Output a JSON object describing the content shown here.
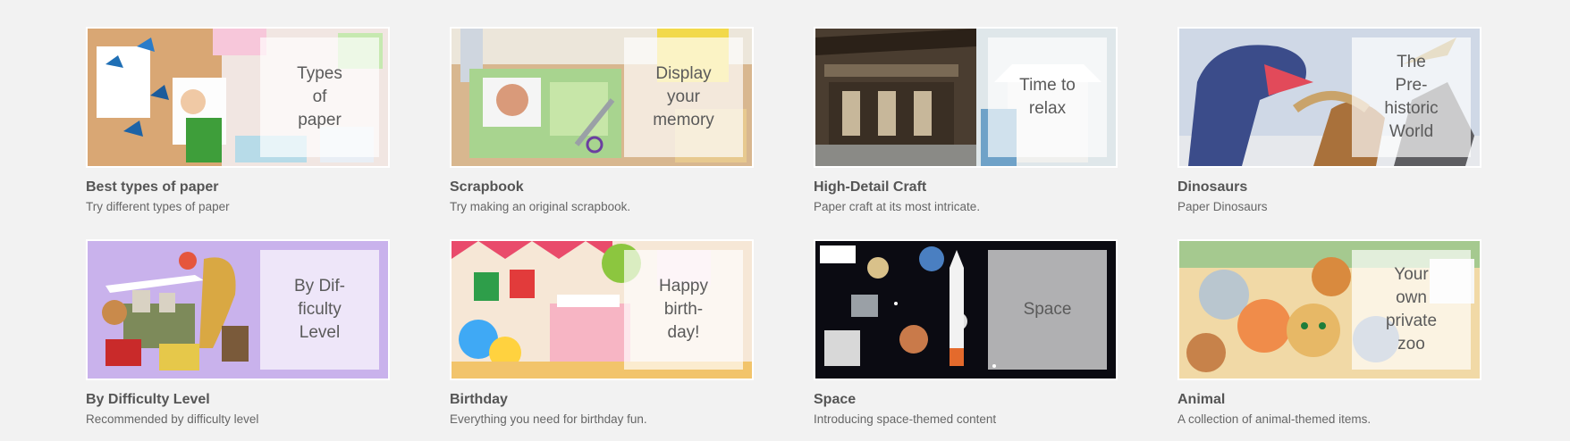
{
  "cards": [
    {
      "overlay": "Types\nof\npaper",
      "title": "Best types of paper",
      "subtitle": "Try different types of paper"
    },
    {
      "overlay": "Display\nyour\nmemory",
      "title": "Scrapbook",
      "subtitle": "Try making an original scrapbook."
    },
    {
      "overlay": "Time to\nrelax",
      "title": "High-Detail Craft",
      "subtitle": "Paper craft at its most intricate."
    },
    {
      "overlay": "The\nPre-\nhistoric\nWorld",
      "title": "Dinosaurs",
      "subtitle": "Paper Dinosaurs"
    },
    {
      "overlay": "By Dif-\nficulty\nLevel",
      "title": "By Difficulty Level",
      "subtitle": "Recommended by difficulty level"
    },
    {
      "overlay": "Happy\nbirth-\nday!",
      "title": "Birthday",
      "subtitle": "Everything you need for birthday fun."
    },
    {
      "overlay": "Space",
      "title": "Space",
      "subtitle": "Introducing space-themed content"
    },
    {
      "overlay": "Your\nown\nprivate\nzoo",
      "title": "Animal",
      "subtitle": "A collection of animal-themed items."
    }
  ],
  "colors": {
    "page_background": "#f2f2f2",
    "title_text": "#555555",
    "subtitle_text": "#666666"
  }
}
